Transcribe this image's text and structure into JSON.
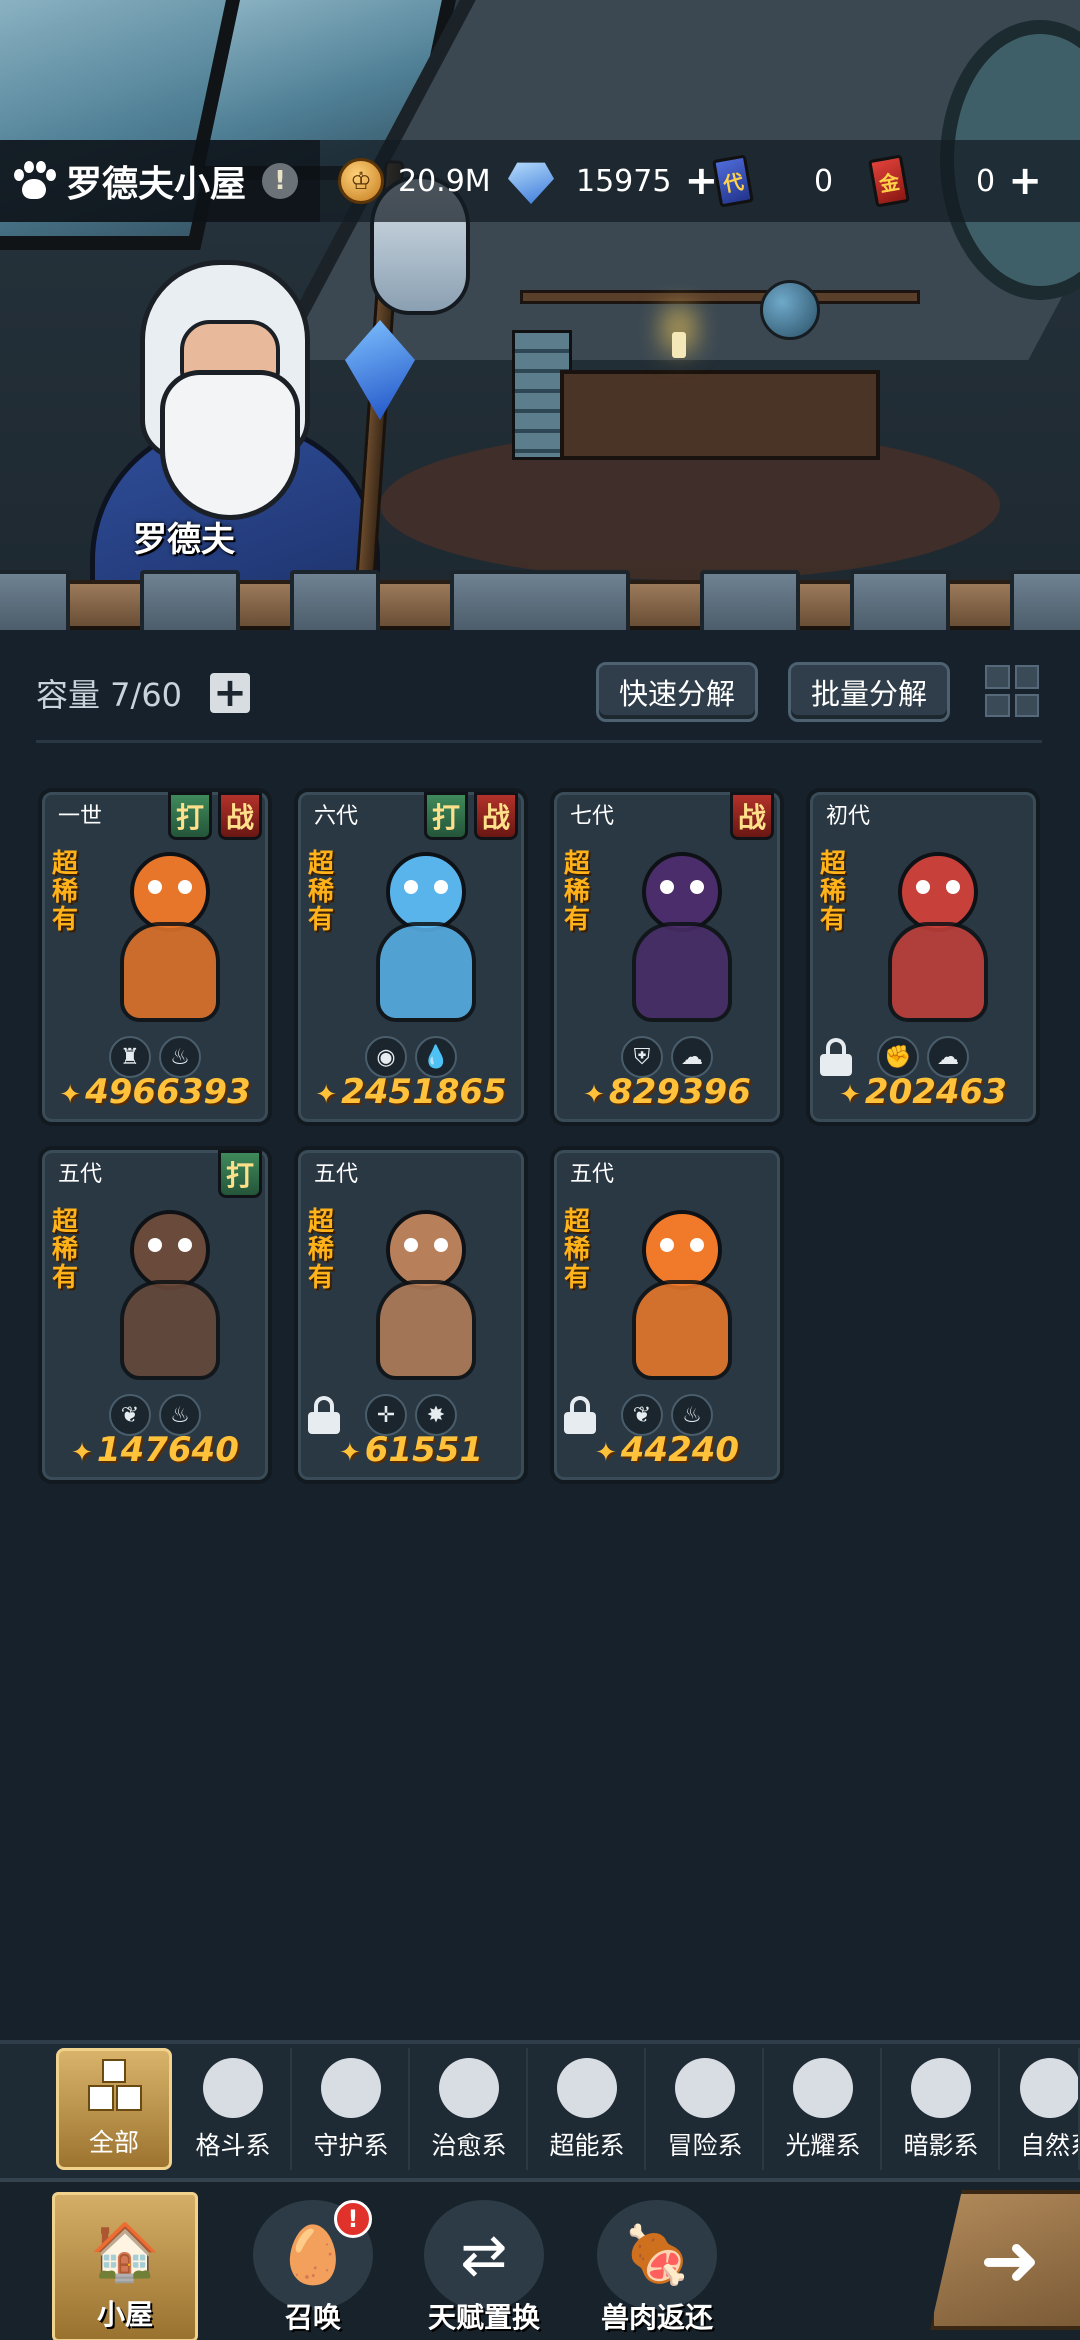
{
  "header": {
    "title": "罗德夫小屋",
    "info_icon": "!",
    "npc_name": "罗德夫"
  },
  "currencies": [
    {
      "name": "coin",
      "icon": "coin-icon",
      "value": "20.9M",
      "has_plus": false
    },
    {
      "name": "crystal",
      "icon": "crystal-icon",
      "value": "15975",
      "has_plus": true
    },
    {
      "name": "generation-card",
      "icon": "card-icon",
      "icon_text": "代",
      "value": "0",
      "has_plus": false
    },
    {
      "name": "gold-card",
      "icon": "card-icon",
      "icon_text": "金",
      "value": "0",
      "has_plus": true
    }
  ],
  "storage": {
    "capacity_label": "容量 7/60",
    "quick_decompose": "快速分解",
    "batch_decompose": "批量分解"
  },
  "pets": [
    {
      "generation": "一世",
      "rarity": "超稀有",
      "tags": [
        "打",
        "战"
      ],
      "elements": [
        "adventure",
        "fire"
      ],
      "locked": false,
      "power": "4966393",
      "art_color": "#e8762a"
    },
    {
      "generation": "六代",
      "rarity": "超稀有",
      "tags": [
        "打",
        "战"
      ],
      "elements": [
        "psychic",
        "water"
      ],
      "locked": false,
      "power": "2451865",
      "art_color": "#5ab4ec"
    },
    {
      "generation": "七代",
      "rarity": "超稀有",
      "tags": [
        "战"
      ],
      "elements": [
        "guard",
        "earth"
      ],
      "locked": false,
      "power": "829396",
      "art_color": "#4a2d6a"
    },
    {
      "generation": "初代",
      "rarity": "超稀有",
      "tags": [],
      "elements": [
        "fighting",
        "earth"
      ],
      "locked": true,
      "power": "202463",
      "art_color": "#c8403a"
    },
    {
      "generation": "五代",
      "rarity": "超稀有",
      "tags": [
        "打"
      ],
      "elements": [
        "healing",
        "fire"
      ],
      "locked": false,
      "power": "147640",
      "art_color": "#6a4a3a"
    },
    {
      "generation": "五代",
      "rarity": "超稀有",
      "tags": [],
      "elements": [
        "light",
        "thunder"
      ],
      "locked": true,
      "power": "61551",
      "art_color": "#b8805a"
    },
    {
      "generation": "五代",
      "rarity": "超稀有",
      "tags": [],
      "elements": [
        "healing",
        "fire"
      ],
      "locked": true,
      "power": "44240",
      "art_color": "#f07a2a"
    }
  ],
  "categories": [
    {
      "label": "全部",
      "icon": "all-icon",
      "active": true
    },
    {
      "label": "格斗系",
      "icon": "fist-icon",
      "active": false
    },
    {
      "label": "守护系",
      "icon": "shield-icon",
      "active": false
    },
    {
      "label": "治愈系",
      "icon": "sprout-icon",
      "active": false
    },
    {
      "label": "超能系",
      "icon": "alien-icon",
      "active": false
    },
    {
      "label": "冒险系",
      "icon": "lantern-icon",
      "active": false
    },
    {
      "label": "光耀系",
      "icon": "star-icon",
      "active": false
    },
    {
      "label": "暗影系",
      "icon": "shadow-icon",
      "active": false
    },
    {
      "label": "自然系",
      "icon": "leaf-icon",
      "active": false
    }
  ],
  "bottom_nav": [
    {
      "label": "小屋",
      "icon": "house-icon",
      "active": true
    },
    {
      "label": "召唤",
      "icon": "egg-icon",
      "active": false,
      "badge": "!"
    },
    {
      "label": "天赋置换",
      "icon": "swap-icon",
      "active": false
    },
    {
      "label": "兽肉返还",
      "icon": "meat-icon",
      "active": false
    }
  ],
  "colors": {
    "power": "#ffc23a",
    "rarity": "#ffb21a",
    "tag_da": "#3f8a5a",
    "tag_zhan": "#b2322a",
    "active_tab": "#d9b36a"
  }
}
